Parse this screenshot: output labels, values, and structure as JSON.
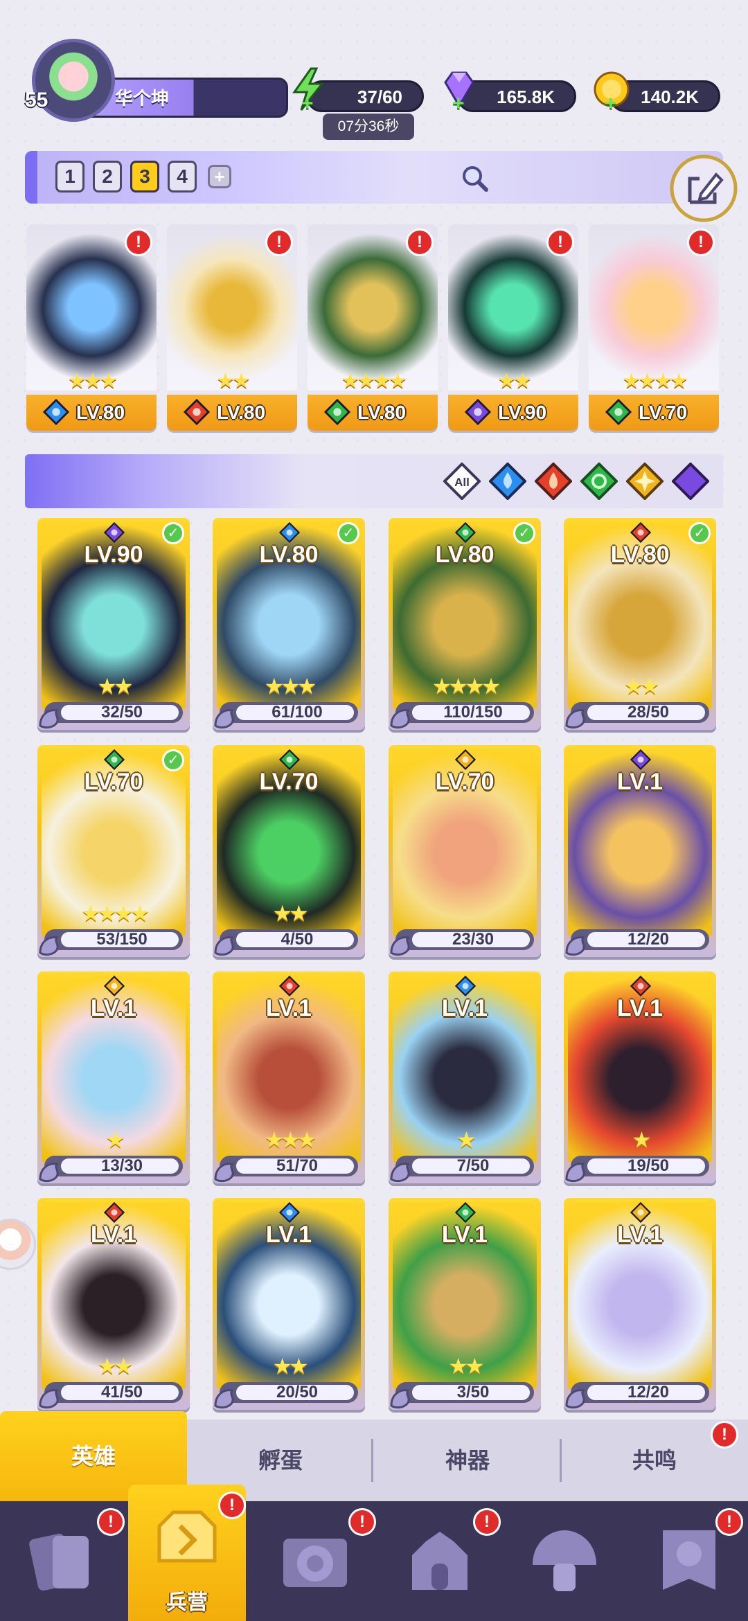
{
  "player": {
    "level": "55",
    "name": "华个坤"
  },
  "resources": {
    "energy": {
      "value": "37/60",
      "timer": "07分36秒",
      "icon": "lightning-icon"
    },
    "gems": {
      "value": "165.8K",
      "icon": "gem-icon"
    },
    "coins": {
      "value": "140.2K",
      "icon": "coin-icon"
    }
  },
  "team_tabs": [
    "1",
    "2",
    "3",
    "4"
  ],
  "team_tab_active": "3",
  "team_add": "+",
  "team": [
    {
      "lv": "LV.80",
      "element": "water",
      "stars": "★★★",
      "alert": "!",
      "art": [
        "#27314f",
        "#7ec2ff"
      ]
    },
    {
      "lv": "LV.80",
      "element": "fire",
      "stars": "★★",
      "alert": "!",
      "art": [
        "#f6e6bb",
        "#e8b83a"
      ]
    },
    {
      "lv": "LV.80",
      "element": "wind",
      "stars": "★★★★",
      "alert": "!",
      "art": [
        "#3c6b39",
        "#e2c15b"
      ]
    },
    {
      "lv": "LV.90",
      "element": "dark",
      "stars": "★★",
      "alert": "!",
      "art": [
        "#173a35",
        "#57e3b0"
      ]
    },
    {
      "lv": "LV.70",
      "element": "wind",
      "stars": "★★★★",
      "alert": "!",
      "art": [
        "#f8cbd8",
        "#ffd08a"
      ]
    }
  ],
  "filters": {
    "all": "All",
    "items": [
      "water",
      "fire",
      "wind",
      "light",
      "dark"
    ]
  },
  "heroes": [
    {
      "lv": "LV.90",
      "element": "dark",
      "stars": "★★",
      "progress": "32/50",
      "checked": true,
      "art": [
        "#1f2740",
        "#7fe0da"
      ]
    },
    {
      "lv": "LV.80",
      "element": "water",
      "stars": "★★★",
      "progress": "61/100",
      "checked": true,
      "art": [
        "#2f4a66",
        "#9fd5f5"
      ]
    },
    {
      "lv": "LV.80",
      "element": "wind",
      "stars": "★★★★",
      "progress": "110/150",
      "checked": true,
      "art": [
        "#3d6b33",
        "#d9b24c"
      ]
    },
    {
      "lv": "LV.80",
      "element": "fire",
      "stars": "★★",
      "progress": "28/50",
      "checked": true,
      "art": [
        "#f4e4bc",
        "#d7a63a"
      ]
    },
    {
      "lv": "LV.70",
      "element": "wind",
      "stars": "★★★★",
      "progress": "53/150",
      "checked": true,
      "art": [
        "#f6f1e0",
        "#f5d56a"
      ]
    },
    {
      "lv": "LV.70",
      "element": "wind",
      "stars": "★★",
      "progress": "4/50",
      "checked": false,
      "art": [
        "#1f2a24",
        "#4ccf63"
      ]
    },
    {
      "lv": "LV.70",
      "element": "light",
      "stars": "",
      "progress": "23/30",
      "checked": false,
      "art": [
        "#f7dd8a",
        "#f0a37c"
      ]
    },
    {
      "lv": "LV.1",
      "element": "dark",
      "stars": "",
      "progress": "12/20",
      "checked": false,
      "art": [
        "#6a4fa8",
        "#f5c260"
      ]
    },
    {
      "lv": "LV.1",
      "element": "light",
      "stars": "★",
      "progress": "13/30",
      "checked": false,
      "art": [
        "#f4d9e2",
        "#9fd7f5"
      ]
    },
    {
      "lv": "LV.1",
      "element": "fire",
      "stars": "★★★",
      "progress": "51/70",
      "checked": false,
      "art": [
        "#f1b985",
        "#b84f3a"
      ]
    },
    {
      "lv": "LV.1",
      "element": "water",
      "stars": "★",
      "progress": "7/50",
      "checked": false,
      "art": [
        "#9ad1f2",
        "#2a2b3e"
      ]
    },
    {
      "lv": "LV.1",
      "element": "fire",
      "stars": "★",
      "progress": "19/50",
      "checked": false,
      "art": [
        "#e5482f",
        "#2d1f2e"
      ]
    },
    {
      "lv": "LV.1",
      "element": "fire",
      "stars": "★★",
      "progress": "41/50",
      "checked": false,
      "art": [
        "#f2e6ea",
        "#2a2026"
      ]
    },
    {
      "lv": "LV.1",
      "element": "water",
      "stars": "★★",
      "progress": "20/50",
      "checked": false,
      "art": [
        "#2b4f7a",
        "#dff1ff"
      ]
    },
    {
      "lv": "LV.1",
      "element": "wind",
      "stars": "★★",
      "progress": "3/50",
      "checked": false,
      "art": [
        "#3fa048",
        "#d5ae62"
      ]
    },
    {
      "lv": "LV.1",
      "element": "light",
      "stars": "",
      "progress": "12/20",
      "checked": false,
      "art": [
        "#e9eefd",
        "#c2b6ef"
      ]
    }
  ],
  "sub_tabs": [
    {
      "label": "英雄",
      "active": true,
      "alert": ""
    },
    {
      "label": "孵蛋",
      "active": false,
      "alert": ""
    },
    {
      "label": "神器",
      "active": false,
      "alert": ""
    },
    {
      "label": "共鸣",
      "active": false,
      "alert": "!"
    }
  ],
  "bottom_nav": [
    {
      "label": "",
      "icon": "cards-icon",
      "alert": "!",
      "active": false
    },
    {
      "label": "兵营",
      "icon": "barracks-icon",
      "alert": "!",
      "active": true
    },
    {
      "label": "",
      "icon": "scroll-icon",
      "alert": "!",
      "active": false
    },
    {
      "label": "",
      "icon": "castle-icon",
      "alert": "!",
      "active": false
    },
    {
      "label": "",
      "icon": "mushroom-icon",
      "alert": "",
      "active": false
    },
    {
      "label": "",
      "icon": "banner-icon",
      "alert": "!",
      "active": false
    }
  ],
  "colors": {
    "water": "#2a8ff0",
    "fire": "#e5402a",
    "wind": "#2eb84a",
    "light": "#f2b41c",
    "dark": "#7a4ae0",
    "accent": "#ffcc1a",
    "panel": "#3b3558"
  }
}
